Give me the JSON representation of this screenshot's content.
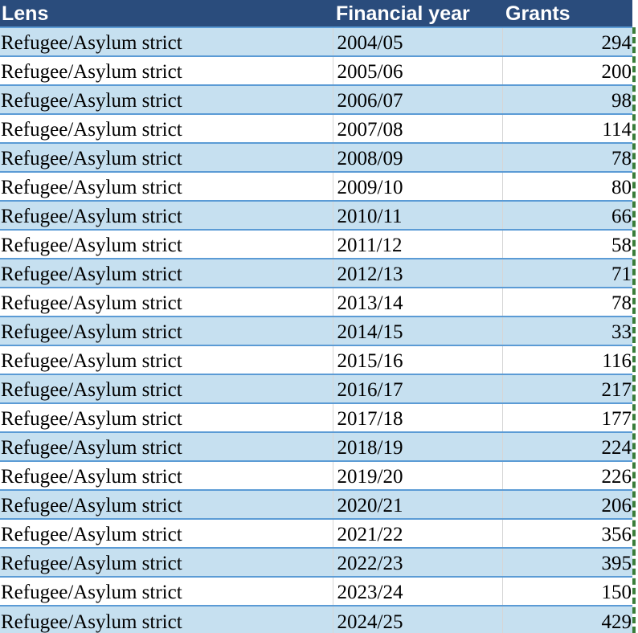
{
  "table": {
    "headers": {
      "lens": "Lens",
      "financial_year": "Financial year",
      "grants": "Grants"
    },
    "rows": [
      {
        "lens": "Refugee/Asylum strict",
        "year": "2004/05",
        "grants": "294"
      },
      {
        "lens": "Refugee/Asylum strict",
        "year": "2005/06",
        "grants": "200"
      },
      {
        "lens": "Refugee/Asylum strict",
        "year": "2006/07",
        "grants": "98"
      },
      {
        "lens": "Refugee/Asylum strict",
        "year": "2007/08",
        "grants": "114"
      },
      {
        "lens": "Refugee/Asylum strict",
        "year": "2008/09",
        "grants": "78"
      },
      {
        "lens": "Refugee/Asylum strict",
        "year": "2009/10",
        "grants": "80"
      },
      {
        "lens": "Refugee/Asylum strict",
        "year": "2010/11",
        "grants": "66"
      },
      {
        "lens": "Refugee/Asylum strict",
        "year": "2011/12",
        "grants": "58"
      },
      {
        "lens": "Refugee/Asylum strict",
        "year": "2012/13",
        "grants": "71"
      },
      {
        "lens": "Refugee/Asylum strict",
        "year": "2013/14",
        "grants": "78"
      },
      {
        "lens": "Refugee/Asylum strict",
        "year": "2014/15",
        "grants": "33"
      },
      {
        "lens": "Refugee/Asylum strict",
        "year": "2015/16",
        "grants": "116"
      },
      {
        "lens": "Refugee/Asylum strict",
        "year": "2016/17",
        "grants": "217"
      },
      {
        "lens": "Refugee/Asylum strict",
        "year": "2017/18",
        "grants": "177"
      },
      {
        "lens": "Refugee/Asylum strict",
        "year": "2018/19",
        "grants": "224"
      },
      {
        "lens": "Refugee/Asylum strict",
        "year": "2019/20",
        "grants": "226"
      },
      {
        "lens": "Refugee/Asylum strict",
        "year": "2020/21",
        "grants": "206"
      },
      {
        "lens": "Refugee/Asylum strict",
        "year": "2021/22",
        "grants": "356"
      },
      {
        "lens": "Refugee/Asylum strict",
        "year": "2022/23",
        "grants": "395"
      },
      {
        "lens": "Refugee/Asylum strict",
        "year": "2023/24",
        "grants": "150"
      },
      {
        "lens": "Refugee/Asylum strict",
        "year": "2024/25",
        "grants": "429"
      }
    ]
  },
  "colors": {
    "header_background": "#2a4c7c",
    "header_text": "#ffffff",
    "band_fill": "#c6e0f0",
    "row_border": "#5b9bd5",
    "page_break_line": "#3a7d3a"
  }
}
